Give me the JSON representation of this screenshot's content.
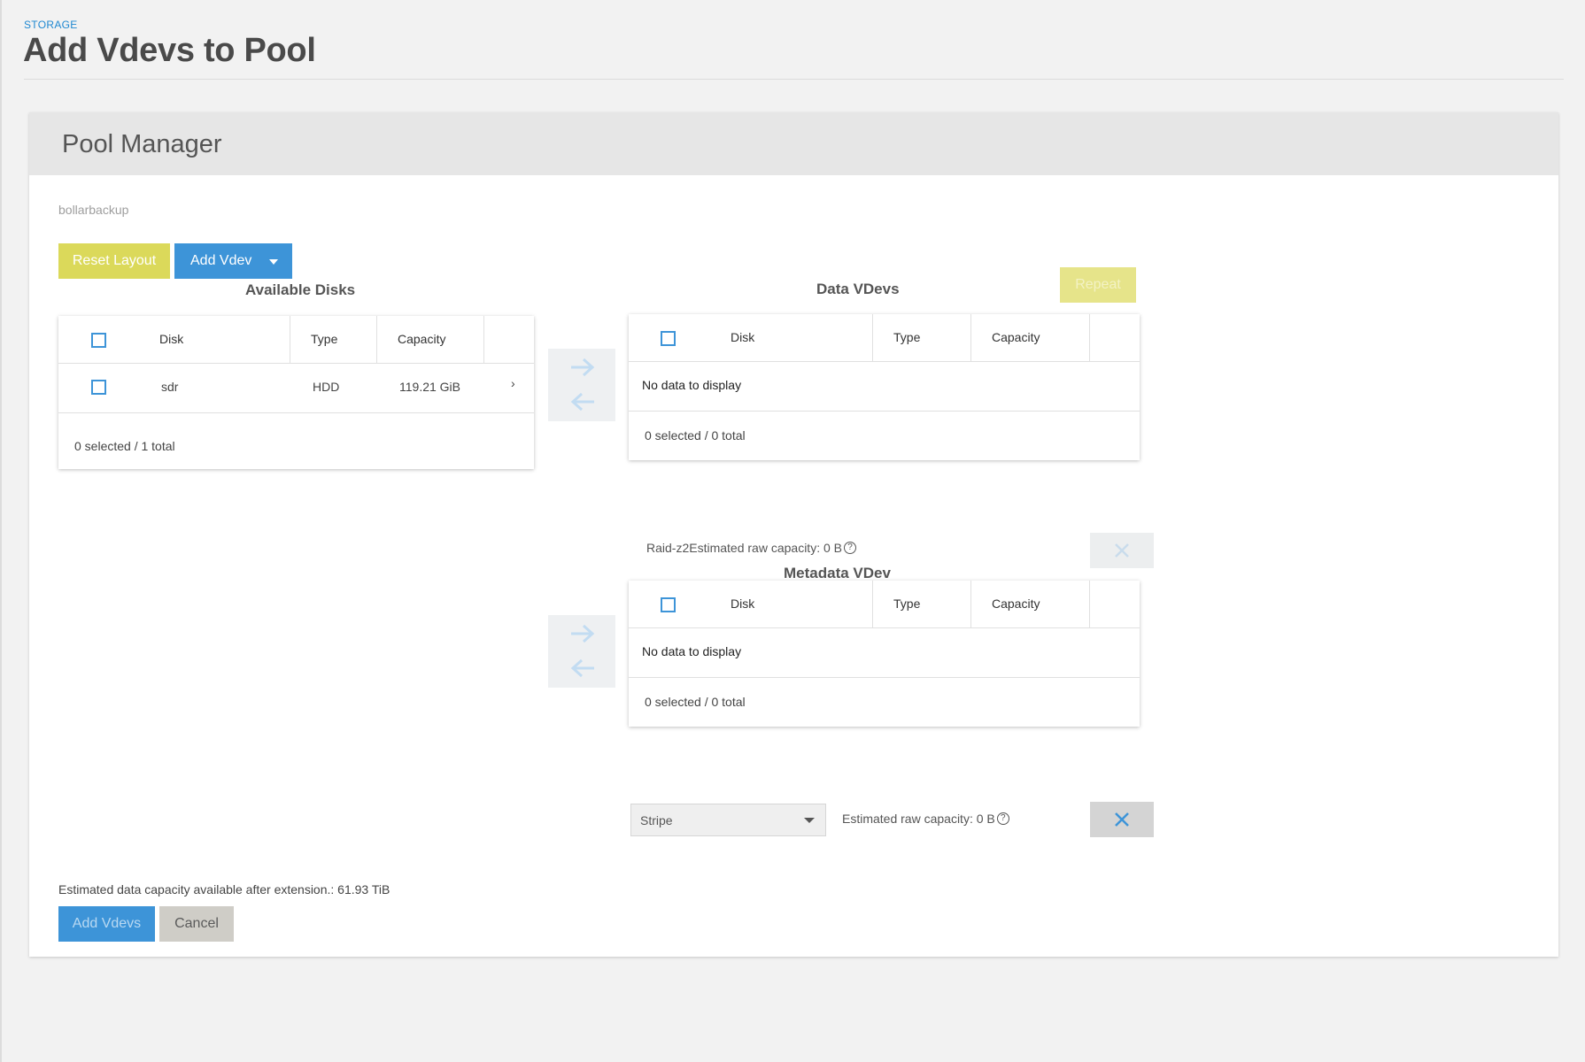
{
  "header": {
    "breadcrumb": "STORAGE",
    "title": "Add Vdevs to Pool"
  },
  "card": {
    "title": "Pool Manager",
    "pool_name": "bollarbackup"
  },
  "toolbar": {
    "reset_label": "Reset Layout",
    "add_vdev_label": "Add Vdev"
  },
  "available": {
    "title": "Available Disks",
    "columns": [
      "Disk",
      "Type",
      "Capacity"
    ],
    "rows": [
      {
        "disk": "sdr",
        "type": "HDD",
        "capacity": "119.21 GiB"
      }
    ],
    "footer": "0 selected / 1 total"
  },
  "data_vdevs": {
    "title": "Data VDevs",
    "repeat_label": "Repeat",
    "columns": [
      "Disk",
      "Type",
      "Capacity"
    ],
    "empty": "No data to display",
    "footer": "0 selected / 0 total",
    "layout": "Raid-z2",
    "estimate": "Estimated raw capacity: 0 B"
  },
  "metadata_vdev": {
    "title": "Metadata VDev",
    "columns": [
      "Disk",
      "Type",
      "Capacity"
    ],
    "empty": "No data to display",
    "footer": "0 selected / 0 total",
    "layout_selected": "Stripe",
    "estimate": "Estimated raw capacity: 0 B"
  },
  "summary": {
    "extension_capacity": "Estimated data capacity available after extension.: 61.93 TiB",
    "add_vdevs_label": "Add Vdevs",
    "cancel_label": "Cancel"
  },
  "colors": {
    "accent_blue": "#3d94d8",
    "accent_yellow": "#dbd95a",
    "breadcrumb_blue": "#1f88d1"
  }
}
